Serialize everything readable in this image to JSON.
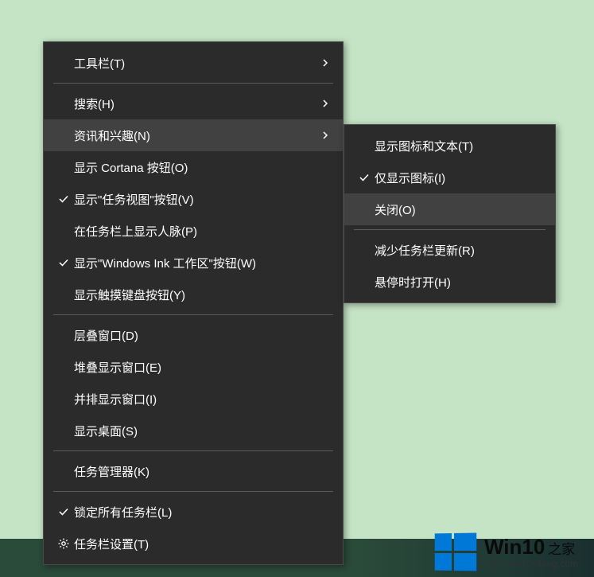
{
  "main_menu": {
    "items": [
      {
        "label": "工具栏(T)",
        "has_arrow": true
      },
      {
        "label": "搜索(H)",
        "has_arrow": true
      },
      {
        "label": "资讯和兴趣(N)",
        "has_arrow": true,
        "highlighted": true
      },
      {
        "label": "显示 Cortana 按钮(O)"
      },
      {
        "label": "显示\"任务视图\"按钮(V)",
        "checked": true
      },
      {
        "label": "在任务栏上显示人脉(P)"
      },
      {
        "label": "显示\"Windows Ink 工作区\"按钮(W)",
        "checked": true
      },
      {
        "label": "显示触摸键盘按钮(Y)"
      },
      {
        "label": "层叠窗口(D)"
      },
      {
        "label": "堆叠显示窗口(E)"
      },
      {
        "label": "并排显示窗口(I)"
      },
      {
        "label": "显示桌面(S)"
      },
      {
        "label": "任务管理器(K)"
      },
      {
        "label": "锁定所有任务栏(L)",
        "checked": true
      },
      {
        "label": "任务栏设置(T)",
        "icon": "gear"
      }
    ]
  },
  "sub_menu": {
    "items": [
      {
        "label": "显示图标和文本(T)"
      },
      {
        "label": "仅显示图标(I)",
        "checked": true
      },
      {
        "label": "关闭(O)",
        "highlighted": true
      },
      {
        "label": "减少任务栏更新(R)"
      },
      {
        "label": "悬停时打开(H)"
      }
    ]
  },
  "watermark": {
    "brand": "Win10",
    "suffix": "之家",
    "url": "www.win10xitong.com"
  }
}
